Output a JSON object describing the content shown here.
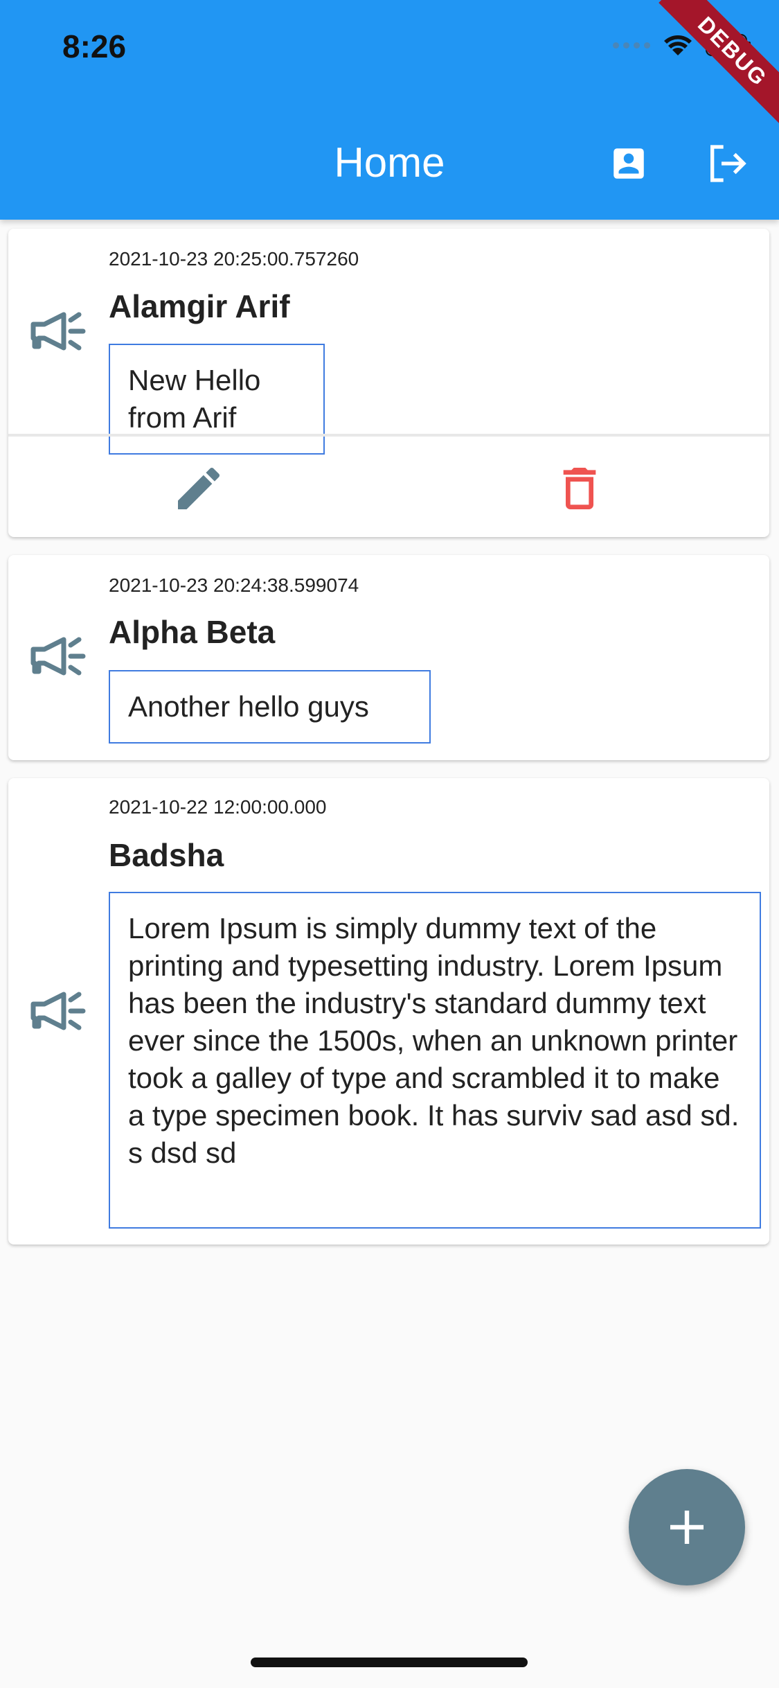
{
  "status_bar": {
    "time": "8:26"
  },
  "debug_banner": "DEBUG",
  "app_bar": {
    "title": "Home",
    "profile_icon": "account-box-icon",
    "logout_icon": "logout-icon"
  },
  "posts": [
    {
      "timestamp": "2021-10-23 20:25:00.757260",
      "author": "Alamgir Arif",
      "message": "New Hello from Arif",
      "actions": {
        "edit_icon": "pencil-icon",
        "delete_icon": "trash-icon"
      }
    },
    {
      "timestamp": "2021-10-23 20:24:38.599074",
      "author": "Alpha Beta",
      "message": "Another hello guys"
    },
    {
      "timestamp": "2021-10-22 12:00:00.000",
      "author": "Badsha",
      "message": "Lorem Ipsum is simply dummy text of the printing and typesetting industry. Lorem Ipsum has been the industry's standard dummy text ever since the 1500s, when an unknown printer took a galley of type and scrambled it to make a type specimen book. It has surviv sad asd sd. s dsd sd"
    }
  ],
  "fab": {
    "icon": "plus-icon"
  },
  "colors": {
    "primary": "#2196f3",
    "fab": "#5f7f8e",
    "icon_gray": "#5f7f8e",
    "delete_red": "#ef5350",
    "message_border": "#3f7be0"
  }
}
